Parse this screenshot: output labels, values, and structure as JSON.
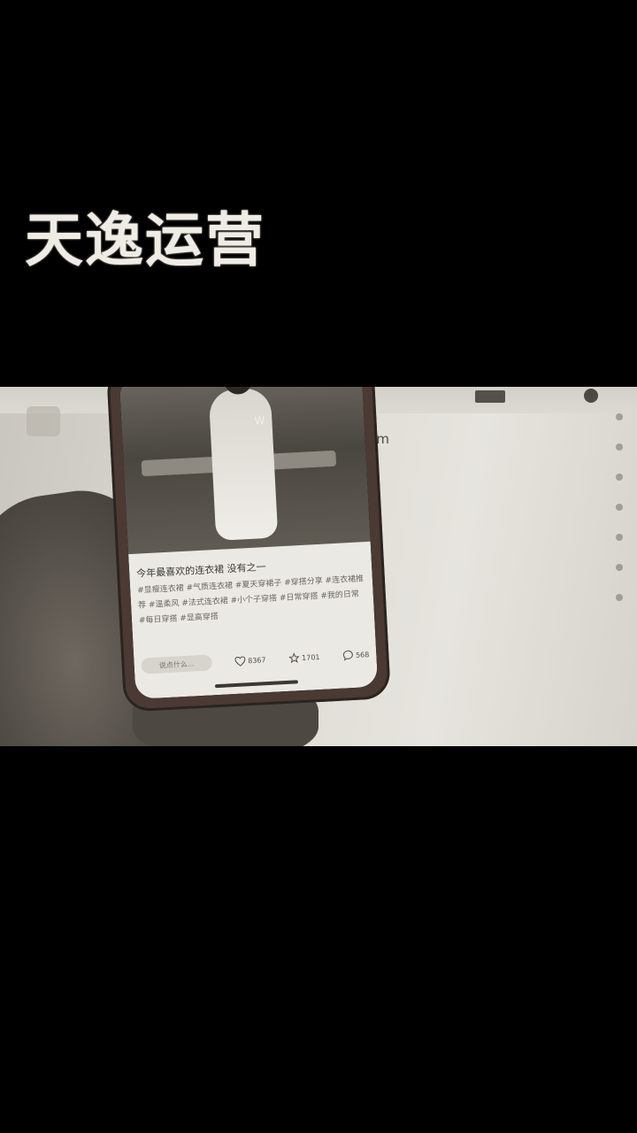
{
  "overlay": {
    "title": "天逸运营"
  },
  "monitor": {
    "url_fragment": "com",
    "badge": "",
    "side_text": [
      "",
      "",
      ""
    ]
  },
  "phone": {
    "watermark": "W",
    "post_title": "今年最喜欢的连衣裙 没有之一",
    "post_tags": "#显瘦连衣裙 #气质连衣裙 #夏天穿裙子 #穿搭分享 #连衣裙推荐 #温柔风 #法式连衣裙 #小个子穿搭 #日常穿搭 #我的日常 #每日穿搭 #显高穿搭",
    "comment_placeholder": "说点什么...",
    "likes": "8367",
    "collects": "1701",
    "comments": "568"
  },
  "icons": {
    "like": "heart-icon",
    "collect": "star-icon",
    "comment": "comment-icon"
  }
}
